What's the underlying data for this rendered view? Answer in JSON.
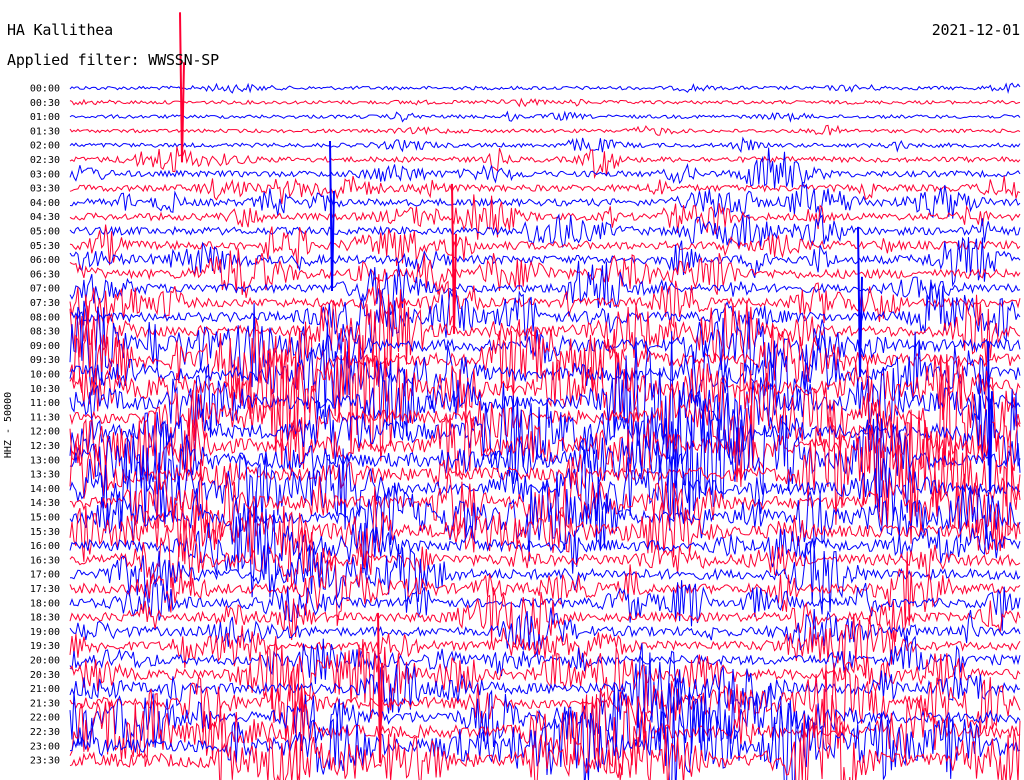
{
  "header": {
    "station": "HA Kallithea",
    "filter": "Applied filter: WWSSN-SP",
    "date": "2021-12-01"
  },
  "chart_data": {
    "type": "line",
    "title": "HA Kallithea",
    "subtitle": "Applied filter: WWSSN-SP",
    "ylabel": "HHZ - 50000",
    "date": "2021-12-01",
    "row_labels": [
      "00:00",
      "00:30",
      "01:00",
      "01:30",
      "02:00",
      "02:30",
      "03:00",
      "03:30",
      "04:00",
      "04:30",
      "05:00",
      "05:30",
      "06:00",
      "06:30",
      "07:00",
      "07:30",
      "08:00",
      "08:30",
      "09:00",
      "09:30",
      "10:00",
      "10:30",
      "11:00",
      "11:30",
      "12:00",
      "12:30",
      "13:00",
      "13:30",
      "14:00",
      "14:30",
      "15:00",
      "15:30",
      "16:00",
      "16:30",
      "17:00",
      "17:30",
      "18:00",
      "18:30",
      "19:00",
      "19:30",
      "20:00",
      "20:30",
      "21:00",
      "21:30",
      "22:00",
      "22:30",
      "23:00",
      "23:30"
    ],
    "series_colors": [
      "#0000ff",
      "#ff0033"
    ],
    "relative_amplitude": [
      1,
      1,
      1,
      1,
      1.5,
      2.5,
      3,
      3.5,
      4,
      4,
      4.5,
      5,
      5,
      5.5,
      5,
      5.5,
      6,
      7,
      8,
      8.5,
      9,
      9,
      9.5,
      9.5,
      9.5,
      9.5,
      9.5,
      9,
      9,
      9,
      8.5,
      8,
      7.5,
      7,
      6.5,
      6,
      5.5,
      5.5,
      5.5,
      5.5,
      6,
      6.5,
      7,
      7.5,
      8,
      8.5,
      9,
      9.5
    ],
    "major_events": [
      {
        "time": "00:30",
        "direction": "spike"
      },
      {
        "time": "05:00",
        "direction": "spike"
      },
      {
        "time": "06:30",
        "direction": "spike"
      },
      {
        "time": "08:00",
        "direction": "spike"
      },
      {
        "time": "12:00",
        "direction": "spike"
      },
      {
        "time": "21:30",
        "direction": "spike"
      }
    ]
  }
}
